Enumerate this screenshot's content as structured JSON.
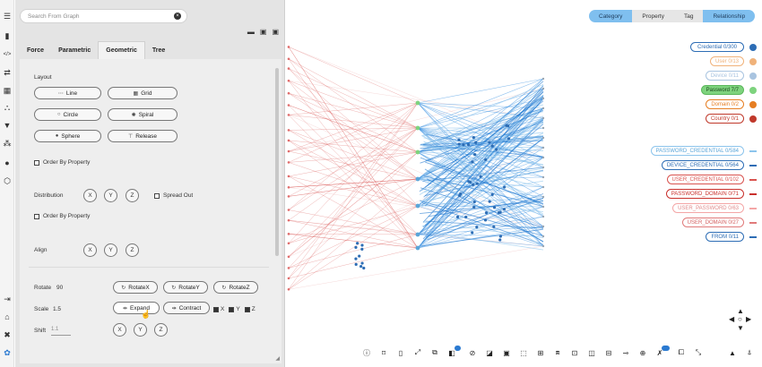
{
  "search": {
    "placeholder": "Search From Graph"
  },
  "panel": {
    "tabs": [
      "Force",
      "Parametric",
      "Geometric",
      "Tree"
    ],
    "layout_label": "Layout",
    "layout_buttons": [
      {
        "label": "Line",
        "icon": "line-icon"
      },
      {
        "label": "Grid",
        "icon": "grid-icon"
      },
      {
        "label": "Circle",
        "icon": "circle-icon"
      },
      {
        "label": "Spiral",
        "icon": "spiral-icon"
      },
      {
        "label": "Sphere",
        "icon": "sphere-icon"
      },
      {
        "label": "Release",
        "icon": "release-icon"
      }
    ],
    "order_by_property": "Order By Property",
    "distribution_label": "Distribution",
    "axis_x": "X",
    "axis_y": "Y",
    "axis_z": "Z",
    "spread_out": "Spread Out",
    "align_label": "Align",
    "rotate_label": "Rotate",
    "rotate_value": "90",
    "rotate_x": "RotateX",
    "rotate_y": "RotateY",
    "rotate_z": "RotateZ",
    "scale_label": "Scale",
    "scale_value": "1.5",
    "expand": "Expand",
    "contract": "Contract",
    "shift_label": "Shift",
    "shift_value": "1.1"
  },
  "view_tabs": [
    "Category",
    "Property",
    "Tag",
    "Relationship"
  ],
  "categories": [
    {
      "label": "Credential 0/300",
      "color": "#2d6db5"
    },
    {
      "label": "User 0/13",
      "color": "#f0b27a"
    },
    {
      "label": "Device 0/11",
      "color": "#a9c4e0"
    },
    {
      "label": "Password 7/7",
      "color": "#7ed37e"
    },
    {
      "label": "Domain 0/2",
      "color": "#e67e22"
    },
    {
      "label": "Country 0/1",
      "color": "#c0392b"
    }
  ],
  "relationships": [
    {
      "label": "PASSWORD_CREDENTIAL 0/584",
      "color": "#8cc4ec"
    },
    {
      "label": "DEVICE_CREDENTIAL 0/564",
      "color": "#2d6db5"
    },
    {
      "label": "USER_CREDENTIAL 0/102",
      "color": "#d9534f"
    },
    {
      "label": "PASSWORD_DOMAIN 0/71",
      "color": "#c9302c"
    },
    {
      "label": "USER_PASSWORD 0/63",
      "color": "#f4a6a6"
    },
    {
      "label": "USER_DOMAIN 0/27",
      "color": "#e07a7a"
    },
    {
      "label": "FROM 0/11",
      "color": "#2d6db5"
    }
  ],
  "toolbar_badge": "81"
}
